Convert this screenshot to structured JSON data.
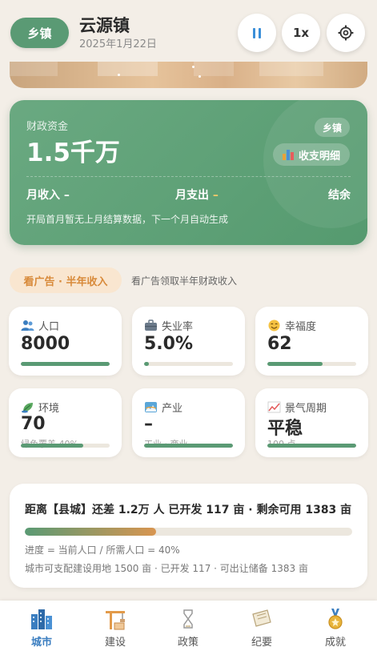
{
  "header": {
    "level_pill": "乡镇",
    "town_name": "云源镇",
    "date": "2025年1月22日",
    "speed_label": "1x",
    "icons": [
      "pause-icon",
      "gear-icon"
    ]
  },
  "finance": {
    "label": "财政资金",
    "value": "1.5千万",
    "badge": "乡镇",
    "detail_button": "收支明细",
    "monthly_income": "月收入 –",
    "monthly_expense": "月支出 –",
    "balance": "结余",
    "note": "开局首月暂无上月结算数据，下一个月自动生成",
    "colors": {
      "card": "#5a9a74",
      "expense_accent": "#f3c96a"
    }
  },
  "ad": {
    "button": "看广告 · 半年收入",
    "description": "看广告领取半年财政收入"
  },
  "stats": [
    {
      "label": "人口",
      "value": "8000",
      "sub": "",
      "progress": 1.0,
      "icon": "people-icon"
    },
    {
      "label": "失业率",
      "value": "5.0%",
      "sub": "",
      "progress": 0.05,
      "icon": "briefcase-icon"
    },
    {
      "label": "幸福度",
      "value": "62",
      "sub": "",
      "progress": 0.62,
      "icon": "smile-icon"
    },
    {
      "label": "环境",
      "value": "70",
      "sub": "绿色覆盖 40%",
      "progress": 0.7,
      "icon": "leaf-icon"
    },
    {
      "label": "产业",
      "value": "–",
      "sub": "工业 · 商业",
      "progress": 1.0,
      "icon": "factory-icon"
    },
    {
      "label": "景气周期",
      "value": "平稳",
      "sub": "100 点",
      "progress": 1.0,
      "icon": "trend-icon"
    }
  ],
  "city": {
    "title": "距离【县城】还差 1.2万 人 已开发 117 亩 · 剩余可用 1383 亩",
    "progress": 0.4,
    "progress_text": "进度 = 当前人口 / 所需人口 = 40%",
    "land_text": "城市可支配建设用地 1500 亩 · 已开发 117 · 可出让储备 1383 亩"
  },
  "nav": [
    {
      "label": "城市",
      "icon": "city-icon",
      "active": true
    },
    {
      "label": "建设",
      "icon": "crane-icon",
      "active": false
    },
    {
      "label": "政策",
      "icon": "hourglass-icon",
      "active": false
    },
    {
      "label": "纪要",
      "icon": "scroll-icon",
      "active": false
    },
    {
      "label": "成就",
      "icon": "medal-icon",
      "active": false
    }
  ]
}
